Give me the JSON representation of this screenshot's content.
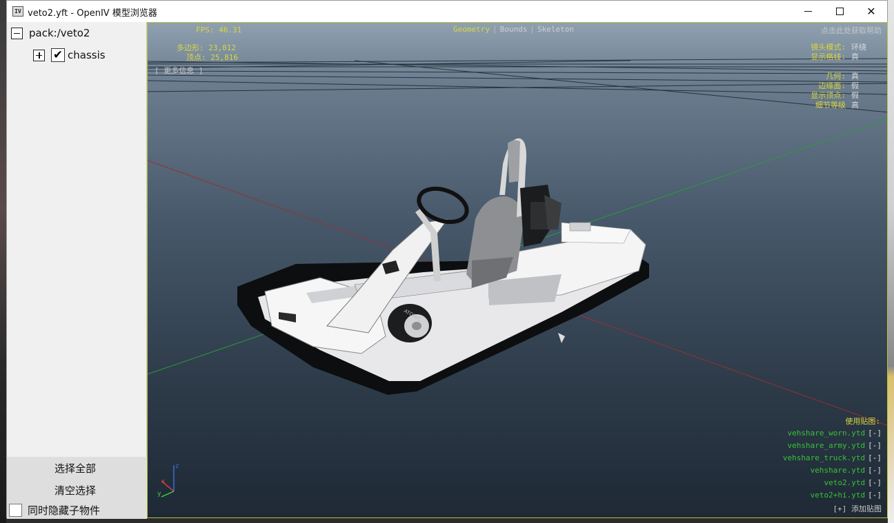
{
  "window": {
    "icon_text": "IV",
    "title": "veto2.yft - OpenIV 模型浏览器",
    "minimize_icon": "minimize-icon",
    "maximize_icon": "maximize-icon",
    "close_icon": "close-icon",
    "close_glyph": "✕"
  },
  "tree": {
    "root_label": "pack:/veto2",
    "child_label": "chassis",
    "child_checked": true,
    "check_glyph": "✔"
  },
  "sidebar_bottom": {
    "select_all": "选择全部",
    "clear_selection": "清空选择",
    "hide_children": "同时隐藏子物件",
    "hide_children_checked": false
  },
  "viewport": {
    "fps": "FPS: 46.31",
    "polygons": "多边形:  23,012",
    "vertices": "顶点:  25,816",
    "more_info": "[ 更多信息 ]",
    "tabs": [
      "Geometry",
      "Bounds",
      "Skeleton"
    ],
    "active_tab": "Geometry",
    "help": "点击此处获取帮助",
    "settings": [
      {
        "key": "镜头模式:",
        "value": "环绕"
      },
      {
        "key": "显示格线:",
        "value": "真"
      },
      {
        "key": "几何:",
        "value": "真"
      },
      {
        "key": "边缘面:",
        "value": "假"
      },
      {
        "key": "显示顶点:",
        "value": "假"
      },
      {
        "key": "细节等级",
        "value": "高"
      }
    ],
    "textures_title": "使用贴图:",
    "textures": [
      "vehshare_worn.ytd",
      "vehshare_army.ytd",
      "vehshare_truck.ytd",
      "vehshare.ytd",
      "veto2.ytd",
      "veto2+hi.ytd"
    ],
    "remove_label": "[-]",
    "add_texture": "[+] 添加贴图",
    "axis_labels": {
      "z": "z",
      "x": "x",
      "y": "y"
    },
    "tire_text": "ATOMIC",
    "colors": {
      "hud_yellow": "#d9d640",
      "hud_green": "#38c238",
      "viewport_border": "#b8c23a"
    }
  }
}
